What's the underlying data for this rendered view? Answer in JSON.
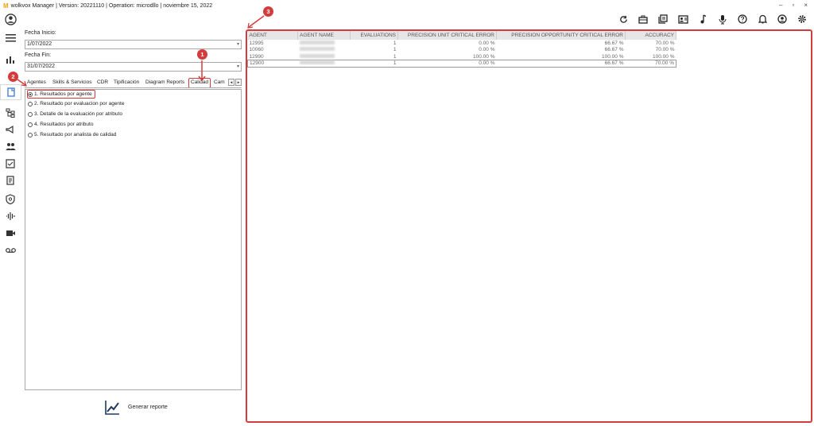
{
  "window": {
    "logo": "M",
    "title": "wolkvox Manager  | Version: 20221110 |  Operation: microdllo | noviembre 15, 2022",
    "minimize": "–",
    "restore": "▫",
    "close": "×"
  },
  "rail": {
    "items": [
      "user-icon",
      "menu-icon",
      "bar-chart-icon",
      "report-icon",
      "tree-icon",
      "campaign-icon",
      "users-icon",
      "checklist-icon",
      "book-icon",
      "shield-icon",
      "audio-wave-icon",
      "video-icon",
      "voicemail-icon"
    ]
  },
  "toolbar": {
    "icons": [
      "refresh-icon",
      "briefcase-icon",
      "copy-icon",
      "contact-card-icon",
      "music-note-icon",
      "microphone-icon",
      "help-icon",
      "bell-icon",
      "account-icon",
      "settings-icon"
    ]
  },
  "filters": {
    "start_label": "Fecha Inicio:",
    "start_value": "1/07/2022",
    "end_label": "Fecha Fin:",
    "end_value": "31/07/2022"
  },
  "tabs": [
    "Agentes",
    "Skills & Servicios",
    "CDR",
    "Tipificación",
    "Diagram Reports",
    "Calidad",
    "Cam"
  ],
  "selected_tab": "Calidad",
  "reports": [
    "1. Resultados por agente",
    "2. Resultado por evaluacion por agente",
    "3. Detalle de la evaluación por atributo",
    "4. Resultados por atributo",
    "5. Resultado por analista de calidad"
  ],
  "generate_label": "Generar reporte",
  "table": {
    "headers": [
      "AGENT",
      "AGENT NAME",
      "EVALUATIONS",
      "PRECISION UNIT CRITICAL ERROR",
      "PRECISION OPPORTUNITY CRITICAL ERROR",
      "ACCURACY"
    ],
    "rows": [
      [
        "12995",
        "",
        "1",
        "0.00 %",
        "66.67 %",
        "70.00 %"
      ],
      [
        "10060",
        "",
        "1",
        "0.00 %",
        "66.67 %",
        "70.00 %"
      ],
      [
        "12990",
        "",
        "1",
        "100.00 %",
        "100.00 %",
        "100.00 %"
      ],
      [
        "12900",
        "",
        "1",
        "0.00 %",
        "66.67 %",
        "70.00 %"
      ]
    ]
  },
  "callouts": [
    "1",
    "2",
    "3"
  ],
  "colors": {
    "accent": "#d43b3b",
    "header_bg": "#e6e6e6",
    "logo": "#e8a317"
  }
}
